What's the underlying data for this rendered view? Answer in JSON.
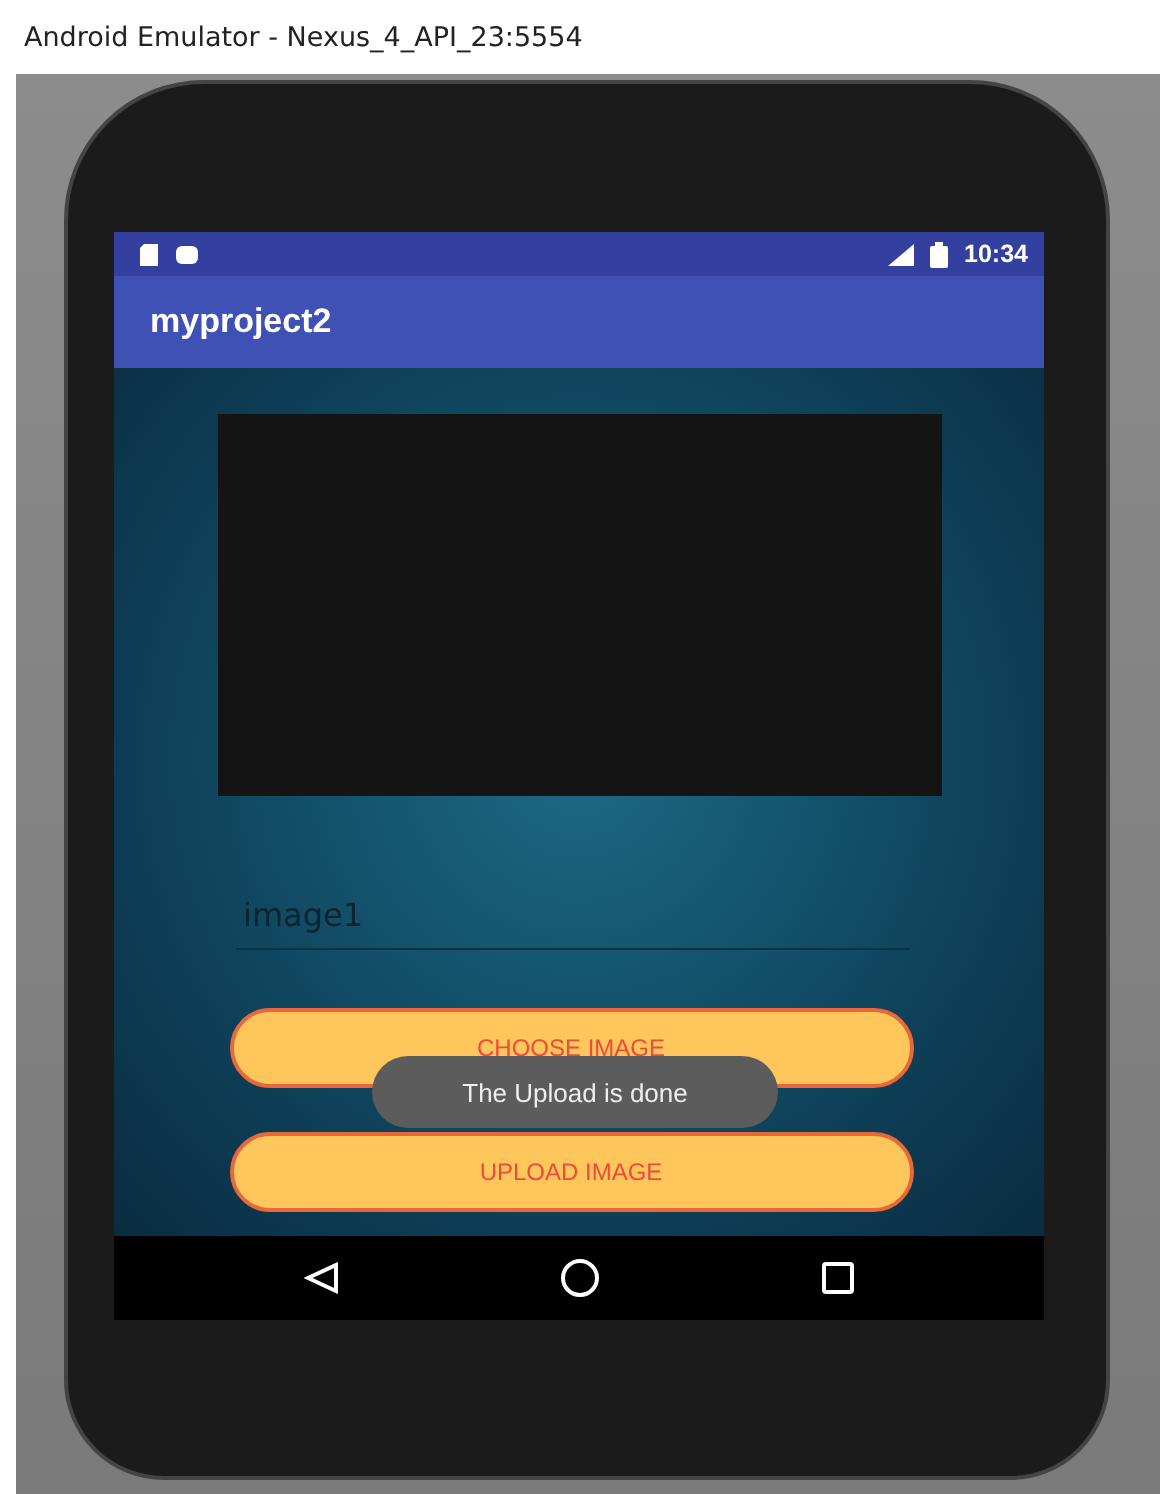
{
  "window": {
    "title": "Android Emulator - Nexus_4_API_23:5554"
  },
  "status_bar": {
    "time": "10:34"
  },
  "app_bar": {
    "title": "myproject2"
  },
  "name_field": {
    "value": "image1"
  },
  "buttons": [
    {
      "label": "CHOOSE IMAGE"
    },
    {
      "label": "UPLOAD IMAGE"
    }
  ],
  "toast": {
    "text": "The Upload is done"
  }
}
